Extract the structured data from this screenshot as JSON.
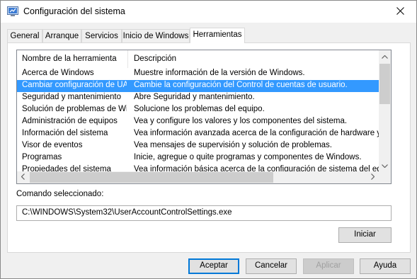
{
  "window": {
    "title": "Configuración del sistema"
  },
  "tabs": [
    {
      "label": "General"
    },
    {
      "label": "Arranque"
    },
    {
      "label": "Servicios"
    },
    {
      "label": "Inicio de Windows"
    },
    {
      "label": "Herramientas"
    }
  ],
  "active_tab": "Herramientas",
  "tools_list": {
    "columns": [
      "Nombre de la herramienta",
      "Descripción"
    ],
    "selected_index": 1,
    "rows": [
      {
        "name": "Acerca de Windows",
        "description": "Muestre información de la versión de Windows."
      },
      {
        "name": "Cambiar configuración de UAC",
        "description": "Cambie la configuración del Control de cuentas de usuario."
      },
      {
        "name": "Seguridad y mantenimiento",
        "description": "Abre Seguridad y mantenimiento."
      },
      {
        "name": "Solución de problemas de Wi...",
        "description": "Solucione los problemas del equipo."
      },
      {
        "name": "Administración de equipos",
        "description": "Vea y configure los valores y los componentes del sistema."
      },
      {
        "name": "Información del sistema",
        "description": "Vea información avanzada acerca de la configuración de hardware y sof"
      },
      {
        "name": "Visor de eventos",
        "description": "Vea mensajes de supervisión y solución de problemas."
      },
      {
        "name": "Programas",
        "description": "Inicie, agregue o quite programas y componentes de Windows."
      },
      {
        "name": "Propiedades del sistema",
        "description": "Vea información básica acerca de la configuración de sistema del equipo"
      }
    ]
  },
  "selected_command": {
    "label": "Comando seleccionado:",
    "value": "C:\\WINDOWS\\System32\\UserAccountControlSettings.exe"
  },
  "buttons": {
    "launch": "Iniciar",
    "ok": "Aceptar",
    "cancel": "Cancelar",
    "apply": "Aplicar",
    "help": "Ayuda"
  },
  "colors": {
    "selection": "#3399ff",
    "default_button_border": "#0078d7"
  }
}
